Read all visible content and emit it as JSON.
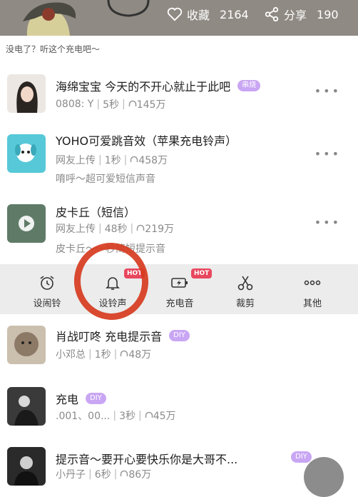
{
  "header": {
    "favorite_label": "收藏",
    "favorite_count": "2164",
    "share_label": "分享",
    "share_count": "190"
  },
  "prompt": "没电了？听这个充电吧～",
  "songs": [
    {
      "title": "海绵宝宝 今天的不开心就止于此吧",
      "tag": "串烧",
      "author": "0808: Y",
      "duration": "5秒",
      "plays": "145万",
      "subtitle": ""
    },
    {
      "title": "YOHO可爱跳音效（苹果充电铃声）",
      "tag": "",
      "author": "网友上传",
      "duration": "1秒",
      "plays": "458万",
      "subtitle": "唷呼～超可爱短信声音"
    },
    {
      "title": "皮卡丘（短信）",
      "tag": "",
      "author": "网友上传",
      "duration": "48秒",
      "plays": "219万",
      "subtitle": "皮卡丘～一秒简短提示音"
    },
    {
      "title": "肖战叮咚 充电提示音",
      "tag": "DIY",
      "author": "小邓总",
      "duration": "1秒",
      "plays": "48万",
      "subtitle": ""
    },
    {
      "title": "充电",
      "tag": "DIY",
      "author": ".001、00...",
      "duration": "3秒",
      "plays": "45万",
      "subtitle": ""
    },
    {
      "title": "提示音～要开心要快乐你是大哥不...",
      "tag": "DIY",
      "author": "小丹子",
      "duration": "6秒",
      "plays": "86万",
      "subtitle": ""
    }
  ],
  "actions": [
    {
      "label": "设闹铃",
      "icon": "alarm-clock-icon",
      "badge": ""
    },
    {
      "label": "设铃声",
      "icon": "bell-icon",
      "badge": "HOT"
    },
    {
      "label": "充电音",
      "icon": "battery-charging-icon",
      "badge": "HOT"
    },
    {
      "label": "裁剪",
      "icon": "scissors-icon",
      "badge": ""
    },
    {
      "label": "其他",
      "icon": "more-icon",
      "badge": ""
    }
  ],
  "more_glyph": "•••",
  "colors": {
    "accent": "#c9a6f3",
    "hot": "#e8475d",
    "annotation": "#d63b1f",
    "header": "#8f8a83"
  }
}
